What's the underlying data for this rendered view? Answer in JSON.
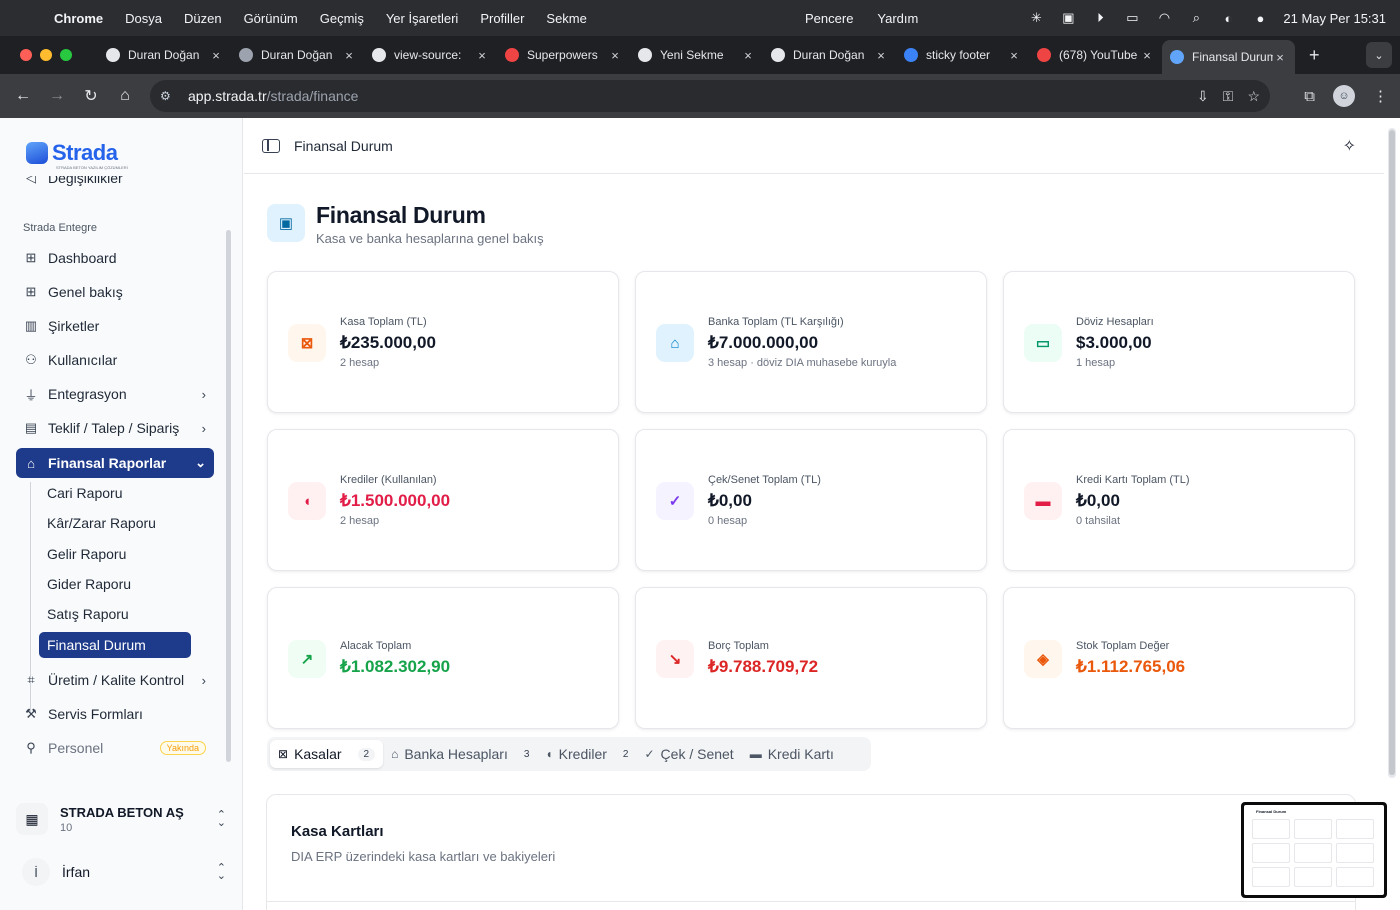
{
  "menubar": {
    "app": "Chrome",
    "items": [
      "Dosya",
      "Düzen",
      "Görünüm",
      "Geçmiş",
      "Yer İşaretleri",
      "Profiller",
      "Sekme"
    ],
    "center_items": [
      "Pencere",
      "Yardım"
    ],
    "clock": "21 May Per  15:31"
  },
  "tabs": [
    {
      "title": "Duran Doğan",
      "favicon_color": "#e5e7eb"
    },
    {
      "title": "Duran Doğan",
      "favicon_color": "#9ca3af"
    },
    {
      "title": "view-source:",
      "favicon_color": "#e5e7eb"
    },
    {
      "title": "Superpowers",
      "favicon_color": "#ef4444"
    },
    {
      "title": "Yeni Sekme",
      "favicon_color": "#e5e7eb"
    },
    {
      "title": "Duran Doğan",
      "favicon_color": "#e5e7eb"
    },
    {
      "title": "sticky footer",
      "favicon_color": "#3b82f6"
    },
    {
      "title": "(678) YouTube",
      "favicon_color": "#ef4444"
    },
    {
      "title": "Finansal Durum",
      "favicon_color": "#60a5fa",
      "active": true
    }
  ],
  "address": {
    "host": "app.strada.tr",
    "path": "/strada/finance"
  },
  "brand": {
    "name": "Strada",
    "tagline": "STRADA BETON YAZILIM ÇÖZÜMLERİ",
    "accent": "#1e3a8a"
  },
  "sidebar": {
    "cut_item": "Değişiklikler",
    "group_label": "Strada Entegre",
    "items": [
      {
        "label": "Dashboard",
        "icon": "grid-icon"
      },
      {
        "label": "Genel bakış",
        "icon": "grid-icon"
      },
      {
        "label": "Şirketler",
        "icon": "building-icon"
      },
      {
        "label": "Kullanıcılar",
        "icon": "users-icon"
      },
      {
        "label": "Entegrasyon",
        "icon": "plug-icon"
      },
      {
        "label": "Teklif / Talep / Sipariş",
        "icon": "clipboard-icon"
      },
      {
        "label": "Finansal Raporlar",
        "icon": "bank-icon"
      }
    ],
    "sub_items": [
      "Cari Raporu",
      "Kâr/Zarar Raporu",
      "Gelir Raporu",
      "Gider Raporu",
      "Satış Raporu",
      "Finansal Durum"
    ],
    "after_items": [
      {
        "label": "Üretim / Kalite Kontrol",
        "icon": "factory-icon"
      },
      {
        "label": "Servis Formları",
        "icon": "wrench-icon"
      },
      {
        "label": "Personel",
        "icon": "user-icon",
        "badge": "Yakında"
      }
    ],
    "org": {
      "name": "STRADA BETON AŞ",
      "sub": "10"
    },
    "user": {
      "initial": "İ",
      "name": "İrfan"
    }
  },
  "header": {
    "breadcrumb": "Finansal Durum"
  },
  "page": {
    "title": "Finansal Durum",
    "subtitle": "Kasa ve banka hesaplarına genel bakış"
  },
  "cards": [
    {
      "label": "Kasa Toplam (TL)",
      "value": "₺235.000,00",
      "sub": "2 hesap",
      "icon": "cash-register-icon",
      "icon_color": "#ea580c",
      "icon_bg": "#fff7ed",
      "value_color": "#111827"
    },
    {
      "label": "Banka Toplam (TL Karşılığı)",
      "value": "₺7.000.000,00",
      "sub": "3 hesap · döviz DIA muhasebe kuruyla",
      "icon": "bank-icon",
      "icon_color": "#0284c7",
      "icon_bg": "#e0f2fe",
      "value_color": "#111827"
    },
    {
      "label": "Döviz Hesapları",
      "value": "$3.000,00",
      "sub": "1 hesap",
      "icon": "banknote-icon",
      "icon_color": "#059669",
      "icon_bg": "#ecfdf5",
      "value_color": "#111827"
    },
    {
      "label": "Krediler (Kullanılan)",
      "value": "₺1.500.000,00",
      "sub": "2 hesap",
      "icon": "piggy-bank-icon",
      "icon_color": "#e11d48",
      "icon_bg": "#fff1f2",
      "value_color": "#e11d48"
    },
    {
      "label": "Çek/Senet Toplam (TL)",
      "value": "₺0,00",
      "sub": "0 hesap",
      "icon": "file-check-icon",
      "icon_color": "#7c3aed",
      "icon_bg": "#f5f3ff",
      "value_color": "#111827"
    },
    {
      "label": "Kredi Kartı Toplam (TL)",
      "value": "₺0,00",
      "sub": "0 tahsilat",
      "icon": "credit-card-icon",
      "icon_color": "#e11d48",
      "icon_bg": "#fff1f2",
      "value_color": "#111827"
    },
    {
      "label": "Alacak Toplam",
      "value": "₺1.082.302,90",
      "sub": "",
      "icon": "arrow-up-right-icon",
      "icon_color": "#16a34a",
      "icon_bg": "#f0fdf4",
      "value_color": "#16a34a"
    },
    {
      "label": "Borç Toplam",
      "value": "₺9.788.709,72",
      "sub": "",
      "icon": "arrow-down-right-icon",
      "icon_color": "#dc2626",
      "icon_bg": "#fef2f2",
      "value_color": "#dc2626"
    },
    {
      "label": "Stok Toplam Değer",
      "value": "₺1.112.765,06",
      "sub": "",
      "icon": "package-icon",
      "icon_color": "#ea580c",
      "icon_bg": "#fff7ed",
      "value_color": "#ea580c"
    }
  ],
  "section_tabs": [
    {
      "label": "Kasalar",
      "count": "2",
      "icon": "cash-register-icon",
      "active": true
    },
    {
      "label": "Banka Hesapları",
      "count": "3",
      "icon": "bank-icon"
    },
    {
      "label": "Krediler",
      "count": "2",
      "icon": "piggy-bank-icon"
    },
    {
      "label": "Çek / Senet",
      "count": "",
      "icon": "file-check-icon"
    },
    {
      "label": "Kredi Kartı",
      "count": "",
      "icon": "credit-card-icon"
    }
  ],
  "panel": {
    "title": "Kasa Kartları",
    "subtitle": "DIA ERP üzerindeki kasa kartları ve bakiyeleri"
  },
  "mini_preview": {
    "title": "Finansal Durum"
  }
}
